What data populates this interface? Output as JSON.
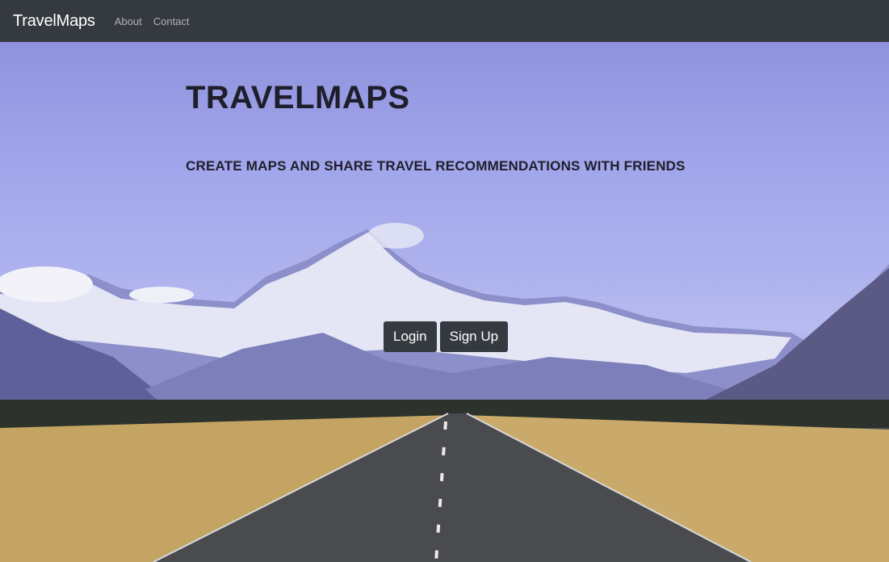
{
  "navbar": {
    "brand": "TravelMaps",
    "links": [
      {
        "label": "About"
      },
      {
        "label": "Contact"
      }
    ]
  },
  "hero": {
    "title": "TRAVELMAPS",
    "subtitle": "CREATE MAPS AND SHARE TRAVEL RECOMMENDATIONS WITH FRIENDS",
    "buttons": {
      "login": "Login",
      "signup": "Sign Up"
    }
  },
  "colors": {
    "navbar_bg": "#343a40",
    "button_bg": "#343a40",
    "sky": "#a2a6ea"
  }
}
